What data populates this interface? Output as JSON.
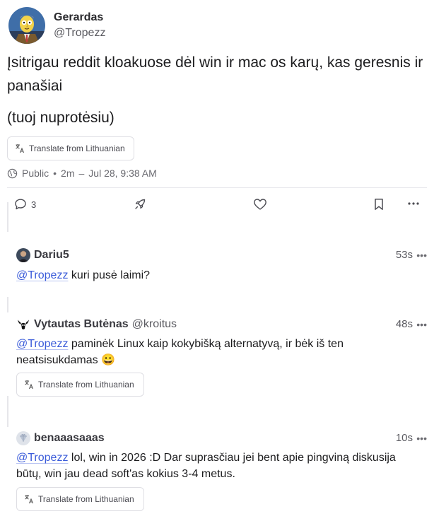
{
  "author": {
    "name": "Gerardas",
    "handle": "@Tropezz",
    "avatar_icon": "cartoon-character-avatar"
  },
  "post": {
    "paragraphs": [
      "Įsitrigau reddit kloakuose dėl win ir mac os karų, kas geresnis ir panašiai",
      "(tuoj nuprotėsiu)"
    ],
    "translate_label": "Translate from Lithuanian",
    "visibility": "Public",
    "time": "2m",
    "date": "Jul 28, 9:38 AM"
  },
  "actions": {
    "reply_count": "3",
    "reply_icon": "comment-icon",
    "boost_icon": "rocket-icon",
    "like_icon": "heart-icon",
    "bookmark_icon": "bookmark-icon",
    "more_icon": "more-icon"
  },
  "replies": [
    {
      "name": "Dariu5",
      "handle": "",
      "time": "53s",
      "mention": "@Tropezz",
      "text": " kuri pusė laimi?"
    },
    {
      "name": "Vytautas Butėnas",
      "handle": "@kroitus",
      "time": "48s",
      "mention": "@Tropezz",
      "text": " paminėk Linux kaip kokybišką alternatyvą, ir bėk iš ten neatsisukdamas 😀",
      "translate_label": "Translate from Lithuanian"
    },
    {
      "name": "benaaasaaas",
      "handle": "",
      "time": "10s",
      "mention": "@Tropezz",
      "text": " lol, win in 2026 :D Dar suprasčiau jei bent apie pingviną diskusija būtų, win jau dead soft'as kokius 3-4 metus.",
      "translate_label": "Translate from Lithuanian"
    }
  ],
  "colors": {
    "mention": "#3a5bd9",
    "text": "#1c1c1e",
    "muted": "#6a6a70",
    "border": "#dedee3"
  }
}
